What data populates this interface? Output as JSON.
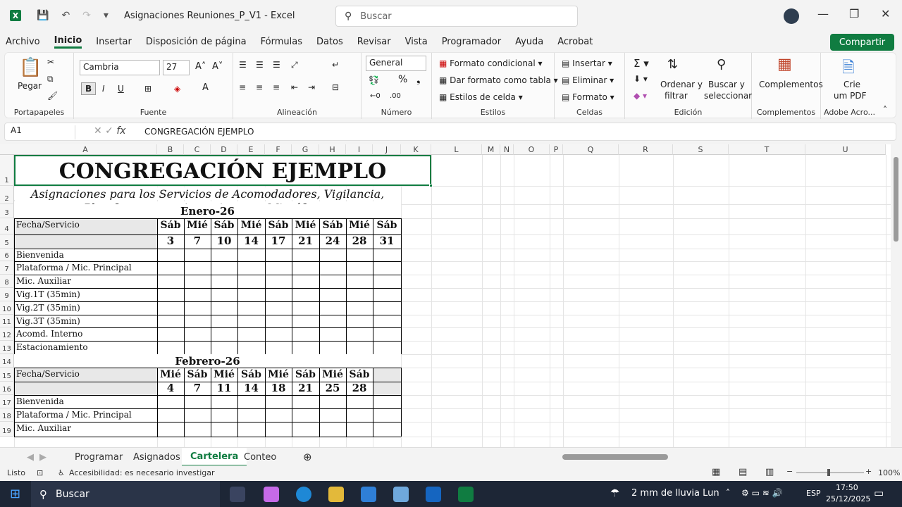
{
  "app": {
    "title": "Asignaciones Reuniones_P_V1 - Excel",
    "search_placeholder": "Buscar"
  },
  "menu": [
    "Archivo",
    "Inicio",
    "Insertar",
    "Disposición de página",
    "Fórmulas",
    "Datos",
    "Revisar",
    "Vista",
    "Programador",
    "Ayuda",
    "Acrobat"
  ],
  "share_label": "Compartir",
  "ribbon": {
    "pegar": "Pegar",
    "groups": [
      "Portapapeles",
      "Fuente",
      "Alineación",
      "Número",
      "Estilos",
      "Celdas",
      "Edición",
      "Complementos",
      "Adobe Acro..."
    ],
    "font_name": "Cambria",
    "font_size": "27",
    "number_format": "General",
    "formato_condicional": "Formato condicional",
    "dar_formato_tabla": "Dar formato como tabla",
    "estilos_celda": "Estilos de celda",
    "insertar": "Insertar",
    "eliminar": "Eliminar",
    "formato": "Formato",
    "ordenar_1": "Ordenar y",
    "ordenar_2": "filtrar",
    "buscar_1": "Buscar y",
    "buscar_2": "seleccionar",
    "complementos": "Complementos",
    "crie_1": "Crie",
    "crie_2": "um PDF"
  },
  "formula_bar": {
    "name_box": "A1",
    "value": "CONGREGACIÓN EJEMPLO"
  },
  "columns": [
    "A",
    "B",
    "C",
    "D",
    "E",
    "F",
    "G",
    "H",
    "I",
    "J",
    "K",
    "L",
    "M",
    "N",
    "O",
    "P",
    "Q",
    "R",
    "S",
    "T",
    "U"
  ],
  "rows": [
    "1",
    "2",
    "3",
    "4",
    "5",
    "6",
    "7",
    "8",
    "9",
    "10",
    "11",
    "12",
    "13",
    "14",
    "15",
    "16",
    "17",
    "18",
    "19"
  ],
  "sheet": {
    "title": "CONGREGACIÓN EJEMPLO",
    "subtitle_1": "Asignaciones para los Servicios de Acomodadores, Vigilancia,",
    "subtitle_2": "Plataforma, estacionamientos y Micrófonos",
    "month_1": "Enero-26",
    "month_2": "Febrero-26",
    "fecha_servicio": "Fecha/Servicio",
    "jan_days": [
      "Sáb",
      "Mié",
      "Sáb",
      "Mié",
      "Sáb",
      "Mié",
      "Sáb",
      "Mié",
      "Sáb"
    ],
    "jan_dates": [
      "3",
      "7",
      "10",
      "14",
      "17",
      "21",
      "24",
      "28",
      "31"
    ],
    "feb_days": [
      "Mié",
      "Sáb",
      "Mié",
      "Sáb",
      "Mié",
      "Sáb",
      "Mié",
      "Sáb"
    ],
    "feb_dates": [
      "4",
      "7",
      "11",
      "14",
      "18",
      "21",
      "25",
      "28"
    ],
    "services": [
      "Bienvenida",
      "Plataforma  / Mic. Principal",
      "Mic. Auxiliar",
      "Vig.1T (35min)",
      "Vig.2T (35min)",
      "Vig.3T (35min)",
      "Acomd. Interno",
      "Estacionamiento"
    ]
  },
  "tabs": [
    "Programar",
    "Asignados",
    "Cartelera",
    "Conteo"
  ],
  "status": {
    "ready": "Listo",
    "accessibility": "Accesibilidad: es necesario investigar",
    "zoom": "100%"
  },
  "taskbar": {
    "search": "Buscar",
    "weather": "2 mm de lluvia Lun",
    "lang": "ESP",
    "time": "17:50",
    "date": "25/12/2025"
  }
}
